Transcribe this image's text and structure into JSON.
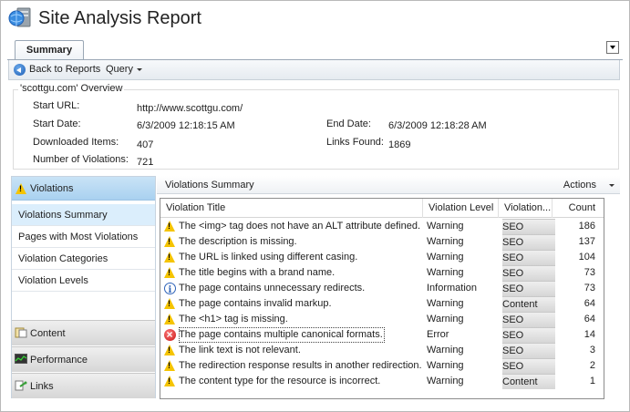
{
  "app": {
    "title": "Site Analysis Report"
  },
  "tabs": [
    {
      "label": "Summary"
    }
  ],
  "toolbar": {
    "back_label": "Back to Reports",
    "query_label": "Query"
  },
  "overview": {
    "legend": "'scottgu.com' Overview",
    "start_url_label": "Start URL:",
    "start_url_value": "http://www.scottgu.com/",
    "start_date_label": "Start Date:",
    "start_date_value": "6/3/2009 12:18:15 AM",
    "end_date_label": "End Date:",
    "end_date_value": "6/3/2009 12:18:28 AM",
    "downloaded_label": "Downloaded Items:",
    "downloaded_value": "407",
    "links_label": "Links Found:",
    "links_value": "1869",
    "violations_label": "Number of Violations:",
    "violations_value": "721"
  },
  "sidebar": {
    "categories": [
      {
        "label": "Violations",
        "icon": "warning-icon"
      },
      {
        "label": "Content",
        "icon": "content-icon"
      },
      {
        "label": "Performance",
        "icon": "performance-icon"
      },
      {
        "label": "Links",
        "icon": "links-icon"
      }
    ],
    "items": [
      {
        "label": "Violations Summary"
      },
      {
        "label": "Pages with Most Violations"
      },
      {
        "label": "Violation Categories"
      },
      {
        "label": "Violation Levels"
      }
    ]
  },
  "panel": {
    "title": "Violations Summary",
    "actions_label": "Actions"
  },
  "table": {
    "columns": [
      "Violation Title",
      "Violation Level",
      "Violation...",
      "Count"
    ],
    "rows": [
      {
        "icon": "warning",
        "title": "The <img> tag does not have an ALT attribute defined.",
        "level": "Warning",
        "category": "SEO",
        "count": "186"
      },
      {
        "icon": "warning",
        "title": "The description is missing.",
        "level": "Warning",
        "category": "SEO",
        "count": "137"
      },
      {
        "icon": "warning",
        "title": "The URL is linked using different casing.",
        "level": "Warning",
        "category": "SEO",
        "count": "104"
      },
      {
        "icon": "warning",
        "title": "The title begins with a brand name.",
        "level": "Warning",
        "category": "SEO",
        "count": "73"
      },
      {
        "icon": "info",
        "title": "The page contains unnecessary redirects.",
        "level": "Information",
        "category": "SEO",
        "count": "73"
      },
      {
        "icon": "warning",
        "title": "The page contains invalid markup.",
        "level": "Warning",
        "category": "Content",
        "count": "64"
      },
      {
        "icon": "warning",
        "title": "The <h1> tag is missing.",
        "level": "Warning",
        "category": "SEO",
        "count": "64"
      },
      {
        "icon": "error",
        "title": "The page contains multiple canonical formats.",
        "level": "Error",
        "category": "SEO",
        "count": "14"
      },
      {
        "icon": "warning",
        "title": "The link text is not relevant.",
        "level": "Warning",
        "category": "SEO",
        "count": "3"
      },
      {
        "icon": "warning",
        "title": "The redirection response results in another redirection.",
        "level": "Warning",
        "category": "SEO",
        "count": "2"
      },
      {
        "icon": "warning",
        "title": "The content type for the resource is incorrect.",
        "level": "Warning",
        "category": "Content",
        "count": "1"
      }
    ]
  },
  "colors": {
    "accent": "#a9d1f0",
    "warning": "#f5c400",
    "error": "#c71414",
    "info": "#2d62b8"
  }
}
